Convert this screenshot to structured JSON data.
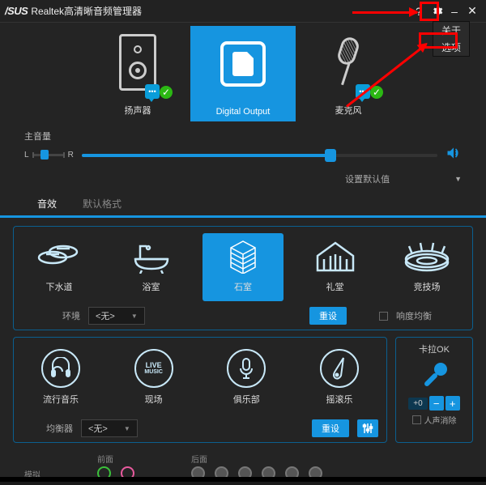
{
  "titlebar": {
    "logo": "/SUS",
    "title": "Realtek高清晰音频管理器"
  },
  "menu": {
    "about": "关于",
    "options": "选项"
  },
  "devices": {
    "speaker": "扬声器",
    "digital": "Digital Output",
    "mic": "麦克风"
  },
  "volume": {
    "label": "主音量",
    "left": "L",
    "right": "R"
  },
  "default_label": "设置默认值",
  "tabs": {
    "fx": "音效",
    "format": "默认格式"
  },
  "env_presets": {
    "p1": "下水道",
    "p2": "浴室",
    "p3": "石室",
    "p4": "礼堂",
    "p5": "竞技场"
  },
  "env_row": {
    "label": "环境",
    "select": "<无>",
    "reset": "重设",
    "loudness": "响度均衡"
  },
  "music_presets": {
    "m1": "流行音乐",
    "m2": "现场",
    "m3": "俱乐部",
    "m4": "摇滚乐"
  },
  "eq_row": {
    "label": "均衡器",
    "select": "<无>",
    "reset": "重设"
  },
  "karaoke": {
    "title": "卡拉OK",
    "value": "+0",
    "voice_cancel": "人声消除"
  },
  "jacks": {
    "front": "前面",
    "back": "后面",
    "analog": "模拟"
  }
}
